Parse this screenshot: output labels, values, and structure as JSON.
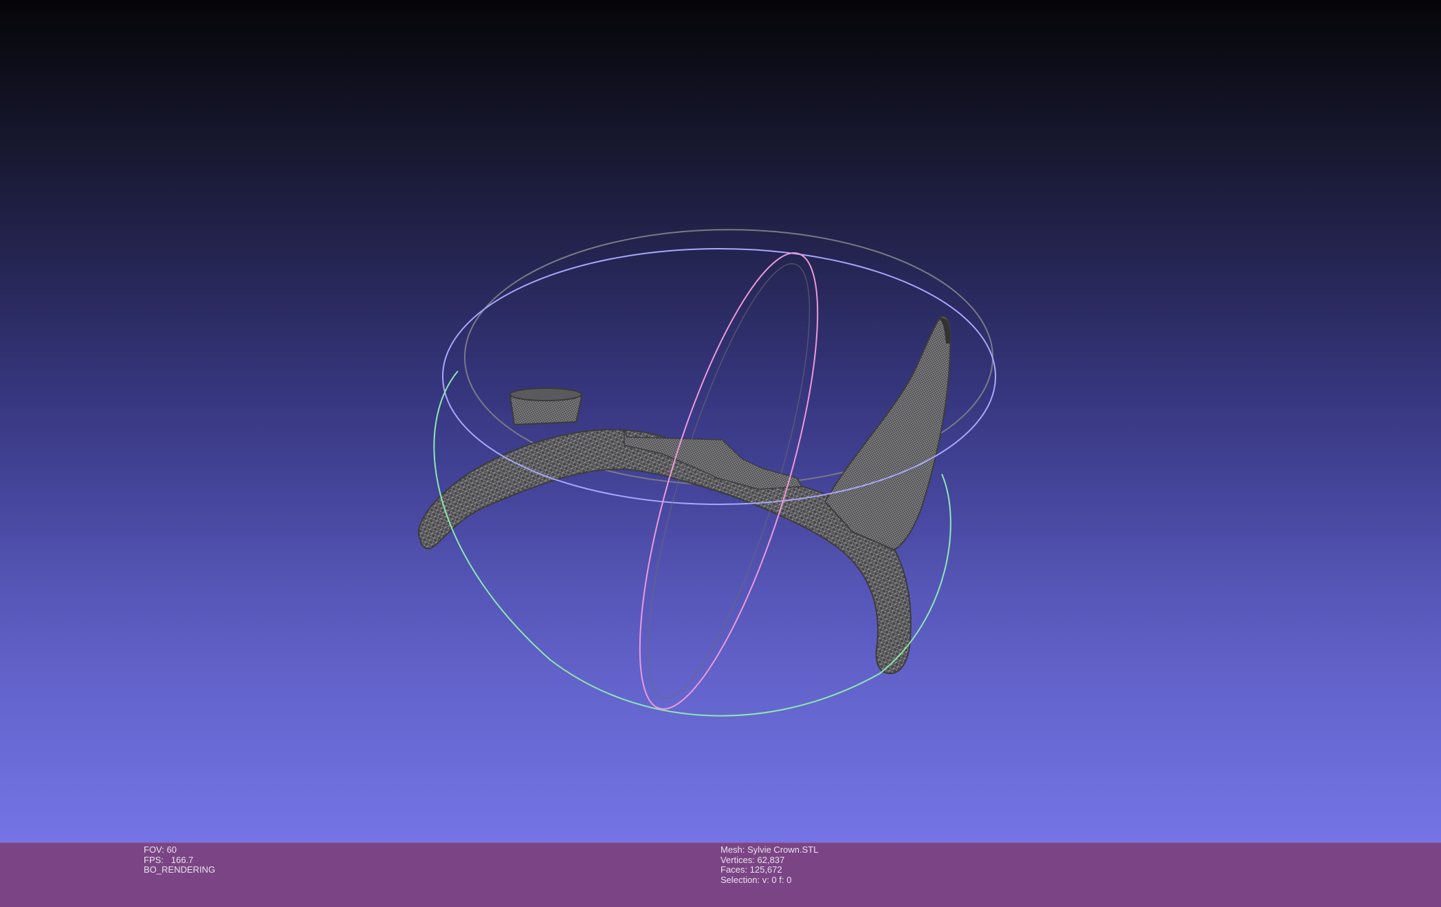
{
  "viewport": {
    "background_top": "#050508",
    "background_bottom": "#7474e6",
    "mesh_color": "#4a4a4c",
    "wire_color": "#9a9a9c",
    "trackball": {
      "x_ring_color": "#ee9ad8",
      "y_ring_color": "#8ee8b0",
      "z_ring_color": "#a8a8ff",
      "inner_ring_color": "#7a7a86"
    }
  },
  "info_bar": {
    "background": "#7b4585",
    "left": {
      "fov": "FOV: 60",
      "fps": "FPS:   166.7",
      "mode": "BO_RENDERING"
    },
    "right": {
      "mesh": "Mesh: Sylvie Crown.STL",
      "vertices": "Vertices: 62,837",
      "faces": "Faces: 125,672",
      "selection": "Selection: v: 0 f: 0"
    }
  }
}
